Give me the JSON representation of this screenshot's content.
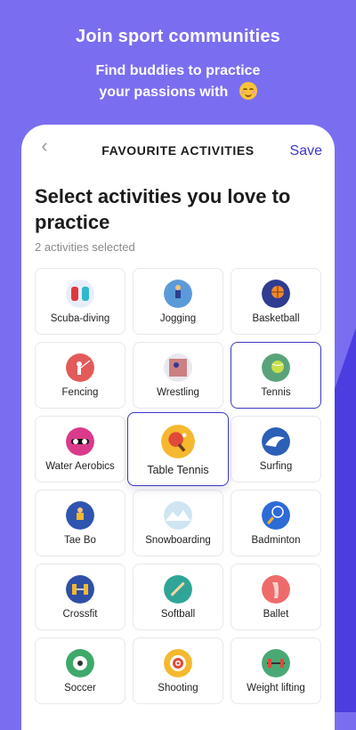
{
  "promo": {
    "title": "Join sport communities",
    "subtitle_line1": "Find buddies to practice",
    "subtitle_line2": "your passions with"
  },
  "header": {
    "title": "FAVOURITE ACTIVITIES",
    "save_label": "Save",
    "back_glyph": "‹"
  },
  "main": {
    "heading": "Select activities you love to practice",
    "selected_count": "2 activities selected"
  },
  "activities": [
    {
      "label": "Scuba-diving",
      "selected": false,
      "icon": "scuba-icon",
      "color": "#e8eef9"
    },
    {
      "label": "Jogging",
      "selected": false,
      "icon": "jogging-icon",
      "color": "#5b9ad8"
    },
    {
      "label": "Basketball",
      "selected": false,
      "icon": "basketball-icon",
      "color": "#2f3c8f"
    },
    {
      "label": "Fencing",
      "selected": false,
      "icon": "fencing-icon",
      "color": "#e25a5a"
    },
    {
      "label": "Wrestling",
      "selected": false,
      "icon": "wrestling-icon",
      "color": "#e8e8ee"
    },
    {
      "label": "Tennis",
      "selected": true,
      "icon": "tennis-icon",
      "color": "#5aa37a"
    },
    {
      "label": "Water Aerobics",
      "selected": false,
      "icon": "water-aerobics-icon",
      "color": "#d93b8a"
    },
    {
      "label": "Table Tennis",
      "selected": true,
      "icon": "table-tennis-icon",
      "color": "#f5b82e"
    },
    {
      "label": "Surfing",
      "selected": false,
      "icon": "surfing-icon",
      "color": "#2b5fb8"
    },
    {
      "label": "Tae Bo",
      "selected": false,
      "icon": "tae-bo-icon",
      "color": "#2f55b0"
    },
    {
      "label": "Snowboarding",
      "selected": false,
      "icon": "snowboarding-icon",
      "color": "#cfe6f2"
    },
    {
      "label": "Badminton",
      "selected": false,
      "icon": "badminton-icon",
      "color": "#2d6bd6"
    },
    {
      "label": "Crossfit",
      "selected": false,
      "icon": "crossfit-icon",
      "color": "#2f4fa6"
    },
    {
      "label": "Softball",
      "selected": false,
      "icon": "softball-icon",
      "color": "#2fa597"
    },
    {
      "label": "Ballet",
      "selected": false,
      "icon": "ballet-icon",
      "color": "#ef6b6b"
    },
    {
      "label": "Soccer",
      "selected": false,
      "icon": "soccer-icon",
      "color": "#3fa86b"
    },
    {
      "label": "Shooting",
      "selected": false,
      "icon": "shooting-icon",
      "color": "#f5b82e"
    },
    {
      "label": "Weight lifting",
      "selected": false,
      "icon": "weightlifting-icon",
      "color": "#4aa875"
    }
  ],
  "colors": {
    "background": "#7a6ef0",
    "accent": "#3b37c8",
    "diagonal": "#4b3de0"
  }
}
